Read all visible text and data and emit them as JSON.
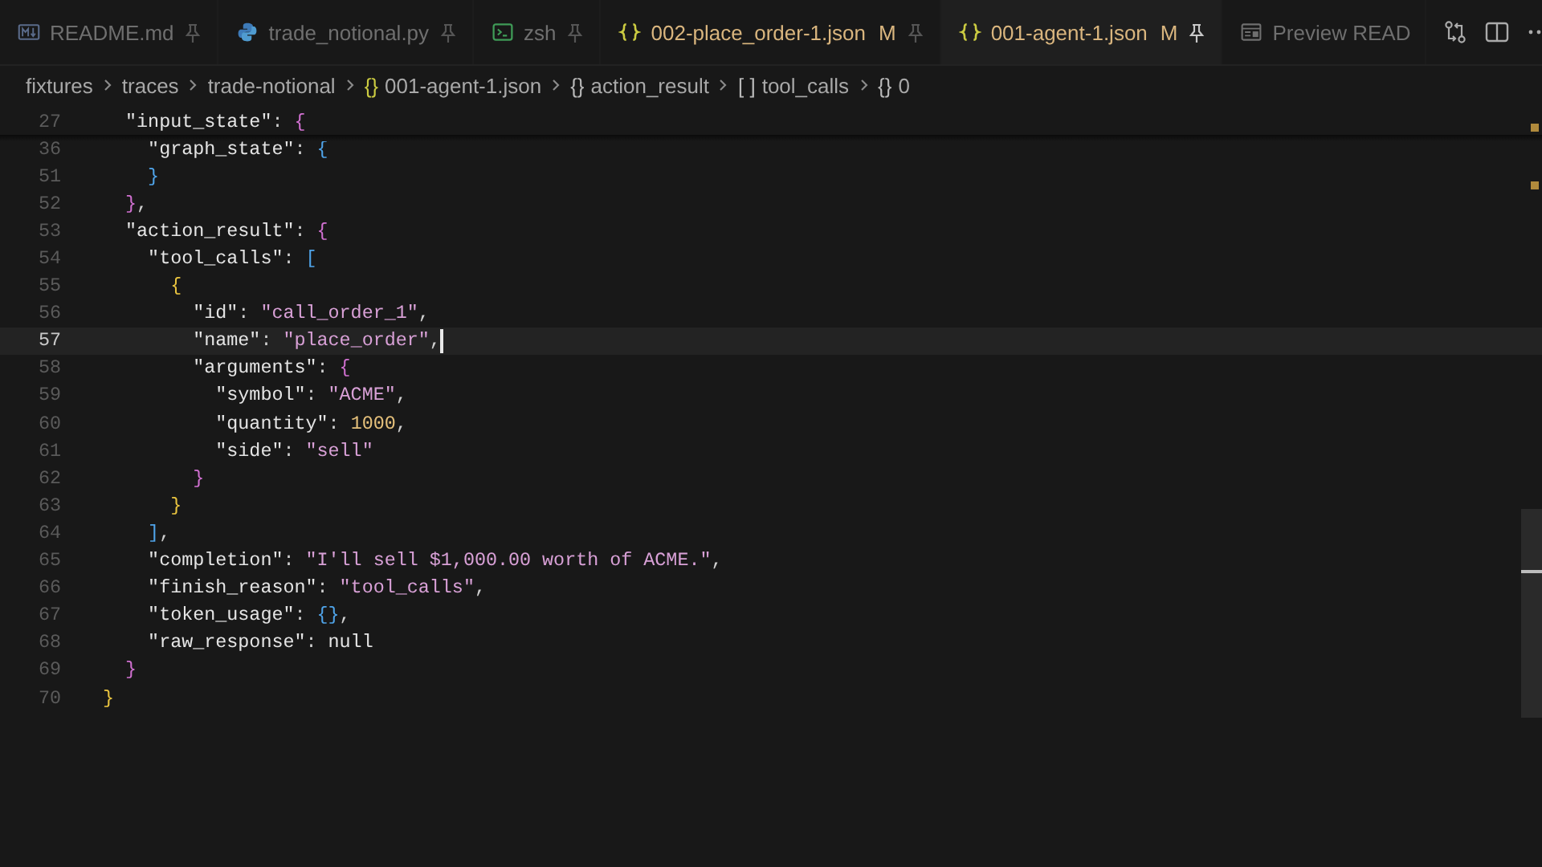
{
  "tabs": [
    {
      "label": "README.md",
      "kind": "markdown",
      "modified": false,
      "selected": false
    },
    {
      "label": "trade_notional.py",
      "kind": "python",
      "modified": false,
      "selected": false
    },
    {
      "label": "zsh",
      "kind": "terminal",
      "modified": false,
      "selected": false
    },
    {
      "label": "002-place_order-1.json",
      "kind": "json",
      "modified": true,
      "selected": false,
      "marker": "M"
    },
    {
      "label": "001-agent-1.json",
      "kind": "json",
      "modified": true,
      "selected": true,
      "marker": "M"
    },
    {
      "label": "Preview READ",
      "kind": "preview",
      "modified": false,
      "selected": false
    }
  ],
  "breadcrumbs": [
    {
      "label": "fixtures"
    },
    {
      "label": "traces"
    },
    {
      "label": "trade-notional"
    },
    {
      "glyph": "{}",
      "kind": "json",
      "label": "001-agent-1.json"
    },
    {
      "glyph": "{}",
      "kind": "object",
      "label": "action_result"
    },
    {
      "glyph": "[ ]",
      "kind": "object",
      "label": "tool_calls"
    },
    {
      "glyph": "{}",
      "kind": "object",
      "label": "0"
    }
  ],
  "editor": {
    "sticky_scroll": true,
    "lines": [
      {
        "n": "27",
        "selected": false,
        "tokens": [
          {
            "kind": "key",
            "text": "  \"input_state\""
          },
          {
            "kind": "p",
            "text": ": "
          },
          {
            "kind": "b2",
            "text": "{"
          }
        ]
      },
      {
        "n": "36",
        "selected": false,
        "tokens": [
          {
            "kind": "key",
            "text": "    \"graph_state\""
          },
          {
            "kind": "p",
            "text": ": "
          },
          {
            "kind": "b3",
            "text": "{"
          }
        ]
      },
      {
        "n": "51",
        "selected": false,
        "tokens": [
          {
            "kind": "b3",
            "text": "    }"
          }
        ]
      },
      {
        "n": "52",
        "selected": false,
        "tokens": [
          {
            "kind": "b2",
            "text": "  }"
          },
          {
            "kind": "p",
            "text": ","
          }
        ]
      },
      {
        "n": "53",
        "selected": false,
        "tokens": [
          {
            "kind": "key",
            "text": "  \"action_result\""
          },
          {
            "kind": "p",
            "text": ": "
          },
          {
            "kind": "b2",
            "text": "{"
          }
        ]
      },
      {
        "n": "54",
        "selected": false,
        "tokens": [
          {
            "kind": "key",
            "text": "    \"tool_calls\""
          },
          {
            "kind": "p",
            "text": ": "
          },
          {
            "kind": "b3",
            "text": "["
          }
        ]
      },
      {
        "n": "55",
        "selected": false,
        "tokens": [
          {
            "kind": "b1",
            "text": "      {"
          }
        ]
      },
      {
        "n": "56",
        "selected": false,
        "tokens": [
          {
            "kind": "key",
            "text": "        \"id\""
          },
          {
            "kind": "p",
            "text": ": "
          },
          {
            "kind": "str",
            "text": "\"call_order_1\""
          },
          {
            "kind": "p",
            "text": ","
          }
        ]
      },
      {
        "n": "57",
        "selected": true,
        "tokens": [
          {
            "kind": "key",
            "text": "        \"name\""
          },
          {
            "kind": "p",
            "text": ": "
          },
          {
            "kind": "str",
            "text": "\"place_order\""
          },
          {
            "kind": "p",
            "text": ","
          }
        ]
      },
      {
        "n": "58",
        "selected": false,
        "tokens": [
          {
            "kind": "key",
            "text": "        \"arguments\""
          },
          {
            "kind": "p",
            "text": ": "
          },
          {
            "kind": "b2",
            "text": "{"
          }
        ]
      },
      {
        "n": "59",
        "selected": false,
        "tokens": [
          {
            "kind": "key",
            "text": "          \"symbol\""
          },
          {
            "kind": "p",
            "text": ": "
          },
          {
            "kind": "str",
            "text": "\"ACME\""
          },
          {
            "kind": "p",
            "text": ","
          }
        ]
      },
      {
        "n": "60",
        "selected": false,
        "tokens": [
          {
            "kind": "key",
            "text": "          \"quantity\""
          },
          {
            "kind": "p",
            "text": ": "
          },
          {
            "kind": "num",
            "text": "1000"
          },
          {
            "kind": "p",
            "text": ","
          }
        ]
      },
      {
        "n": "61",
        "selected": false,
        "tokens": [
          {
            "kind": "key",
            "text": "          \"side\""
          },
          {
            "kind": "p",
            "text": ": "
          },
          {
            "kind": "str",
            "text": "\"sell\""
          }
        ]
      },
      {
        "n": "62",
        "selected": false,
        "tokens": [
          {
            "kind": "b2",
            "text": "        }"
          }
        ]
      },
      {
        "n": "63",
        "selected": false,
        "tokens": [
          {
            "kind": "b1",
            "text": "      }"
          }
        ]
      },
      {
        "n": "64",
        "selected": false,
        "tokens": [
          {
            "kind": "b3",
            "text": "    ]"
          },
          {
            "kind": "p",
            "text": ","
          }
        ]
      },
      {
        "n": "65",
        "selected": false,
        "tokens": [
          {
            "kind": "key",
            "text": "    \"completion\""
          },
          {
            "kind": "p",
            "text": ": "
          },
          {
            "kind": "str",
            "text": "\"I'll sell $1,000.00 worth of ACME.\""
          },
          {
            "kind": "p",
            "text": ","
          }
        ]
      },
      {
        "n": "66",
        "selected": false,
        "tokens": [
          {
            "kind": "key",
            "text": "    \"finish_reason\""
          },
          {
            "kind": "p",
            "text": ": "
          },
          {
            "kind": "str",
            "text": "\"tool_calls\""
          },
          {
            "kind": "p",
            "text": ","
          }
        ]
      },
      {
        "n": "67",
        "selected": false,
        "tokens": [
          {
            "kind": "key",
            "text": "    \"token_usage\""
          },
          {
            "kind": "p",
            "text": ": "
          },
          {
            "kind": "b3",
            "text": "{}"
          },
          {
            "kind": "p",
            "text": ","
          }
        ]
      },
      {
        "n": "68",
        "selected": false,
        "tokens": [
          {
            "kind": "key",
            "text": "    \"raw_response\""
          },
          {
            "kind": "p",
            "text": ": "
          },
          {
            "kind": "kw",
            "text": "null"
          }
        ]
      },
      {
        "n": "69",
        "selected": false,
        "tokens": [
          {
            "kind": "b2",
            "text": "  }"
          }
        ]
      },
      {
        "n": "70",
        "selected": false,
        "tokens": [
          {
            "kind": "b1",
            "text": "}"
          }
        ]
      }
    ]
  }
}
